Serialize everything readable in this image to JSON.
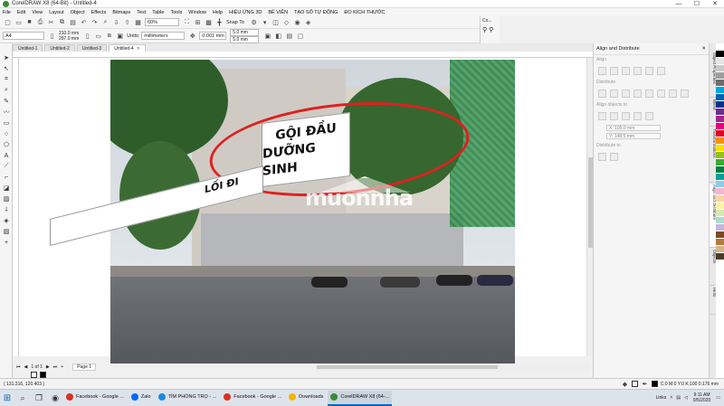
{
  "window": {
    "title": "CorelDRAW X8 (64-Bit) - Untitled-4",
    "minimize": "—",
    "maximize": "☐",
    "close": "✕"
  },
  "menu": [
    "File",
    "Edit",
    "View",
    "Layout",
    "Object",
    "Effects",
    "Bitmaps",
    "Text",
    "Table",
    "Tools",
    "Window",
    "Help",
    "HIỆU ỨNG 3D",
    "BÊ VIỀN",
    "TẠO SỐ TỰ ĐỘNG",
    "ĐO KÍCH THƯỚC"
  ],
  "toolbar": {
    "zoom": "60%",
    "snap_label": "Snap To"
  },
  "propbar": {
    "page_size": "A4",
    "width": "210.0 mm",
    "height": "297.0 mm",
    "units_label": "Units:",
    "units": "millimeters",
    "nudge": "0.001 mm",
    "dup_x": "5.0 mm",
    "dup_y": "5.0 mm"
  },
  "connector_panel": {
    "label": "Co..."
  },
  "tabs": [
    {
      "label": "Untitled-1",
      "active": false
    },
    {
      "label": "Untitled-2",
      "active": false
    },
    {
      "label": "Untitled-3",
      "active": false
    },
    {
      "label": "Untitled-4",
      "active": true
    }
  ],
  "canvas": {
    "sign_line1": "GỘI ĐẦU",
    "sign_line2": "DƯỠNG SINH",
    "entrance_label": "LỐI ĐI",
    "watermark": "muonnha"
  },
  "pagenav": {
    "page_count": "1 of 1",
    "page_tab": "Page 1"
  },
  "statusbar": {
    "coords": "( 131.316, 120.403 )",
    "fill_info": "C:0 M:0 Y:0 K:100 0.176 mm"
  },
  "docker": {
    "title": "Align and Distribute",
    "section_align": "Align",
    "section_distribute": "Distribute",
    "section_objects": "Align objects to",
    "section_spacing": "Distribute to",
    "x_field": "X: 105.0 mm",
    "y_field": "Y: 148.5 mm"
  },
  "side_tabs": [
    "Object Properties",
    "Blend",
    "Transformations",
    "Align and Distribute",
    "Objects",
    "Hints"
  ],
  "swatches": [
    "#ffffff",
    "#000000",
    "#e6e6e6",
    "#c9c9c9",
    "#9e9e9e",
    "#6e6e6e",
    "#00a3e0",
    "#0064b0",
    "#00338a",
    "#6a2c91",
    "#a6228e",
    "#e6007e",
    "#e3001b",
    "#f39200",
    "#ffdd00",
    "#95c11f",
    "#3aaa35",
    "#007f3e",
    "#00a19a",
    "#8fcbe8",
    "#f7b5cf",
    "#fbd3a5",
    "#fff3a3",
    "#d4e8b5",
    "#b0d9d0",
    "#c3b7dc",
    "#7a4a22",
    "#b47a3f",
    "#d9b48a",
    "#4a3b2a"
  ],
  "taskbar": {
    "apps": [
      {
        "label": "Facebook - Google ...",
        "color": "#d93025",
        "active": false
      },
      {
        "label": "Zalo",
        "color": "#0068ff",
        "active": false
      },
      {
        "label": "TÌM PHÒNG TRỌ - ...",
        "color": "#1e88e5",
        "active": false
      },
      {
        "label": "Facebook - Google ...",
        "color": "#d93025",
        "active": false
      },
      {
        "label": "Downloads",
        "color": "#f4b400",
        "active": false
      },
      {
        "label": "CorelDRAW X8 (64-...",
        "color": "#3a8b3a",
        "active": true
      }
    ],
    "links_label": "Links",
    "time": "9:11 AM",
    "date": "9/5/2020"
  }
}
